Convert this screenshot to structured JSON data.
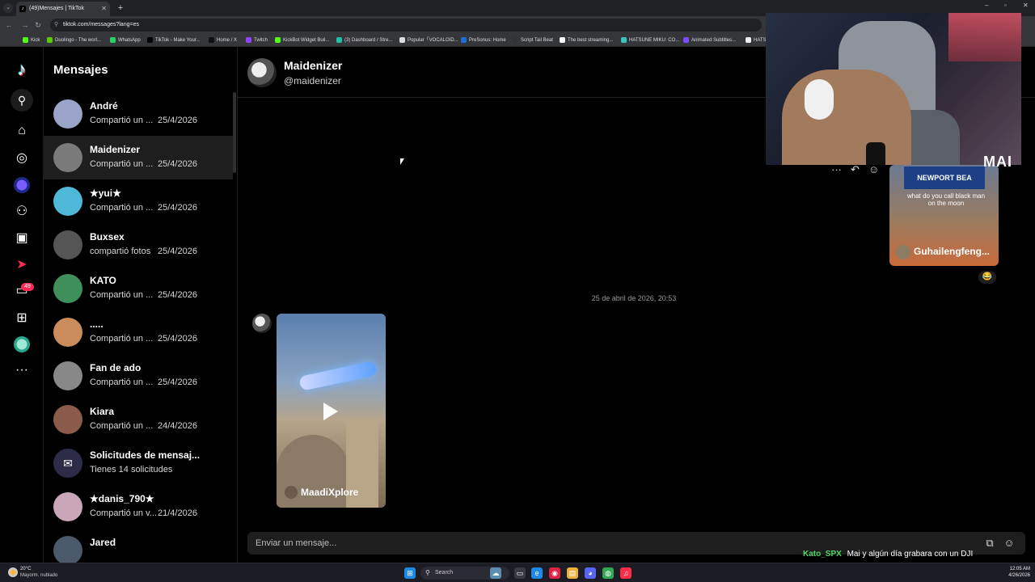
{
  "browser": {
    "tab_title": "(49)Mensajes | TikTok",
    "url": "tiktok.com/messages?lang=es",
    "bookmarks": [
      {
        "label": "Kick",
        "color": "#53fc18"
      },
      {
        "label": "Duolingo - The worl...",
        "color": "#58cc02"
      },
      {
        "label": "WhatsApp",
        "color": "#25d366"
      },
      {
        "label": "TikTok - Make Your...",
        "color": "#000000"
      },
      {
        "label": "Home / X",
        "color": "#111111"
      },
      {
        "label": "Twitch",
        "color": "#9146ff"
      },
      {
        "label": "KickBot Widget Buil...",
        "color": "#53fc18"
      },
      {
        "label": "(3) Dashboard / Stre...",
        "color": "#1fbfa8"
      },
      {
        "label": "Popular「VOCALOID...",
        "color": "#dddddd"
      },
      {
        "label": "PreSonus: Home",
        "color": "#1d6fd8"
      },
      {
        "label": "Script Tail Beat",
        "color": "#333333"
      },
      {
        "label": "The best streaming...",
        "color": "#ffffff"
      },
      {
        "label": "HATSUNE MIKU: CO...",
        "color": "#39c5bb"
      },
      {
        "label": "Animated Subtitles...",
        "color": "#7b4dff"
      },
      {
        "label": "HATS",
        "color": "#eeeeee"
      }
    ]
  },
  "tiktok": {
    "rail_badge": "49",
    "messages_title": "Mensajes",
    "conversations": [
      {
        "name": "André",
        "preview": "Compartió un ...",
        "date": "25/4/2026",
        "avatar_color": "#9aa3c8",
        "active": false
      },
      {
        "name": "Maidenizer",
        "preview": "Compartió un ...",
        "date": "25/4/2026",
        "avatar_color": "#7a7a7a",
        "active": true
      },
      {
        "name": "★yui★",
        "preview": "Compartió un ...",
        "date": "25/4/2026",
        "avatar_color": "#4fb8d8",
        "active": false
      },
      {
        "name": "Buxsex",
        "preview": "compartió fotos",
        "date": "25/4/2026",
        "avatar_color": "#555555",
        "active": false
      },
      {
        "name": "KATO",
        "preview": "Compartió un ...",
        "date": "25/4/2026",
        "avatar_color": "#3f8f5a",
        "active": false
      },
      {
        "name": ".....",
        "preview": "Compartió un ...",
        "date": "25/4/2026",
        "avatar_color": "#c98c5a",
        "active": false
      },
      {
        "name": "Fan de ado",
        "preview": "Compartió un ...",
        "date": "25/4/2026",
        "avatar_color": "#888888",
        "active": false
      },
      {
        "name": "Kiara",
        "preview": "Compartió un ...",
        "date": "24/4/2026",
        "avatar_color": "#8a5a4a",
        "active": false
      },
      {
        "name": "Solicitudes de mensaj...",
        "preview": "Tienes 14 solicitudes",
        "date": "",
        "avatar_color": "#2c2c48",
        "active": false
      },
      {
        "name": "★danis_790★",
        "preview": "Compartió un v...",
        "date": "21/4/2026",
        "avatar_color": "#c9a7b8",
        "active": false
      },
      {
        "name": "Jared",
        "preview": "",
        "date": "",
        "avatar_color": "#4a5a6a",
        "active": false
      }
    ],
    "chat": {
      "name": "Maidenizer",
      "handle": "@maidenizer",
      "sent_video": {
        "sign": "NEWPORT BEA",
        "caption": "what do you call black man on the moon",
        "author": "Guhailengfeng..."
      },
      "reaction": "😂",
      "timestamp": "25 de abril de 2026, 20:53",
      "received_video": {
        "author": "MaadiXplore"
      },
      "composer_placeholder": "Enviar un mensaje..."
    }
  },
  "overlay": {
    "logo": "MAI",
    "chat_user": "Kato_SPX",
    "chat_text": "Mai y algún día grabara con un DJI"
  },
  "taskbar": {
    "temp": "20°C",
    "condition": "Mayorm. nublado",
    "search": "Search",
    "time": "12:05 AM",
    "date": "4/26/2026"
  }
}
